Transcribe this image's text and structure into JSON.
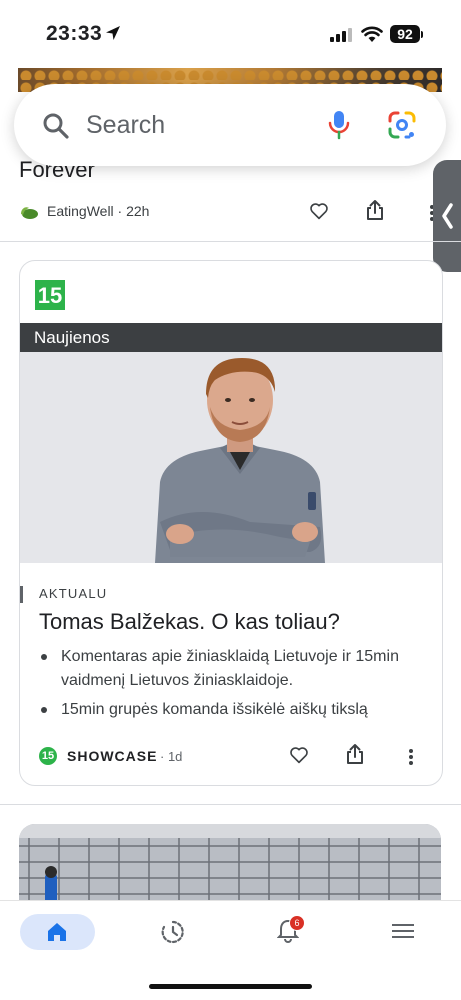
{
  "status_bar": {
    "time": "23:33",
    "battery": "92"
  },
  "search": {
    "placeholder": "Search"
  },
  "previous_card": {
    "title_tail": "Forever",
    "source": "EatingWell",
    "age": "22h",
    "source_line": "EatingWell · 22h"
  },
  "article": {
    "publisher_logo": "15",
    "category": "Naujienos",
    "kicker": "AKTUALU",
    "headline": "Tomas Balžekas. O kas toliau?",
    "bullets": [
      "Komentaras apie žiniasklaidą Lietuvoje ir 15min vaidmenį Lietuvos žiniasklaidoje.",
      "15min grupės komanda išsikėlė aiškų tikslą"
    ],
    "footer": {
      "publisher_badge": "15",
      "label": "SHOWCASE",
      "age": "· 1d"
    }
  },
  "bottom_nav": {
    "items": [
      "home-icon",
      "recent-icon",
      "notifications-icon",
      "menu-icon"
    ],
    "notification_count": "6"
  },
  "colors": {
    "accent": "#1a73e8",
    "publisher_green": "#2db34a",
    "category_bar": "#3c3f42"
  }
}
